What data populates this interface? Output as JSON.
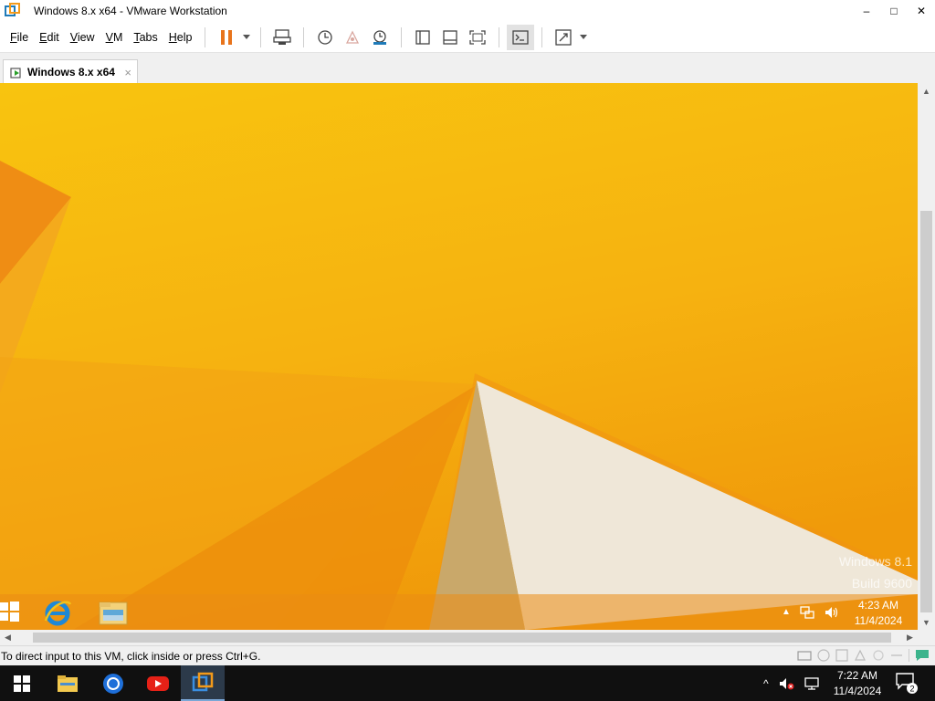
{
  "window": {
    "title": "Windows 8.x x64 - VMware Workstation",
    "controls": {
      "minimize": "–",
      "maximize": "□",
      "close": "✕"
    }
  },
  "menu": {
    "items": [
      {
        "label": "File",
        "key": "F",
        "rest": "ile"
      },
      {
        "label": "Edit",
        "key": "E",
        "rest": "dit"
      },
      {
        "label": "View",
        "key": "V",
        "rest": "iew"
      },
      {
        "label": "VM",
        "key": "V",
        "rest": "M"
      },
      {
        "label": "Tabs",
        "key": "T",
        "rest": "abs"
      },
      {
        "label": "Help",
        "key": "H",
        "rest": "elp"
      }
    ]
  },
  "toolbar": {
    "icons": [
      "pause-icon",
      "dropdown-arrow-icon",
      "send-ctrl-alt-del-icon",
      "snapshot-icon",
      "revert-snapshot-icon",
      "snapshot-manager-icon",
      "show-library-icon",
      "thumbnail-bar-icon",
      "full-screen-icon",
      "console-view-icon",
      "stretch-guest-icon",
      "dropdown-arrow-icon"
    ]
  },
  "tab": {
    "label": "Windows 8.x x64",
    "close": "×"
  },
  "guest": {
    "watermark_line1": "Windows 8.1",
    "watermark_line2": "Build 9600",
    "clock_time": "4:23 AM",
    "clock_date": "11/4/2024",
    "colors": {
      "bg_top": "#f7c310",
      "bg_bottom": "#f19a0a",
      "white_shape": "#efe7d8"
    }
  },
  "statusbar": {
    "text": "To direct input to this VM, click inside or press Ctrl+G."
  },
  "host": {
    "clock_time": "7:22 AM",
    "clock_date": "11/4/2024",
    "notification_count": "2"
  }
}
